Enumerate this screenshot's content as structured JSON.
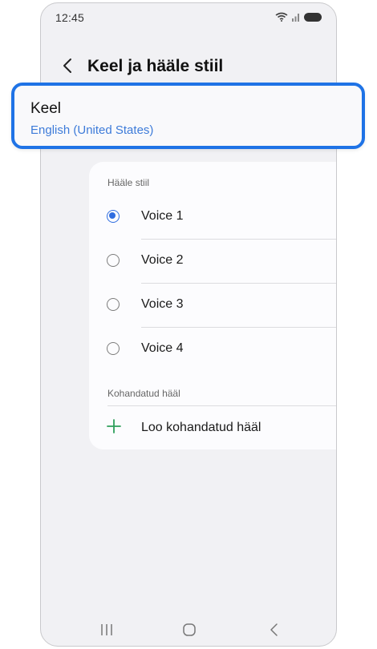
{
  "status_bar": {
    "time": "12:45",
    "icons": [
      "wifi-icon",
      "signal-icon",
      "battery-icon"
    ]
  },
  "header": {
    "back_icon": "chevron-left-icon",
    "title": "Keel ja hääle stiil"
  },
  "language": {
    "title": "Keel",
    "value": "English (United States)"
  },
  "voice_style": {
    "section_label": "Hääle stiil",
    "options": [
      {
        "label": "Voice 1",
        "selected": true
      },
      {
        "label": "Voice 2",
        "selected": false
      },
      {
        "label": "Voice 3",
        "selected": false
      },
      {
        "label": "Voice 4",
        "selected": false
      }
    ]
  },
  "custom_voice": {
    "section_label": "Kohandatud hääl",
    "add_label": "Loo kohandatud hääl",
    "add_icon": "plus-icon"
  },
  "nav_bar": {
    "icons": [
      "recent-apps-icon",
      "home-icon",
      "back-icon"
    ]
  },
  "colors": {
    "accent": "#2f6de0",
    "highlight_border": "#1f73e6",
    "plus": "#2e9e5b",
    "background": "#f1f1f4"
  }
}
